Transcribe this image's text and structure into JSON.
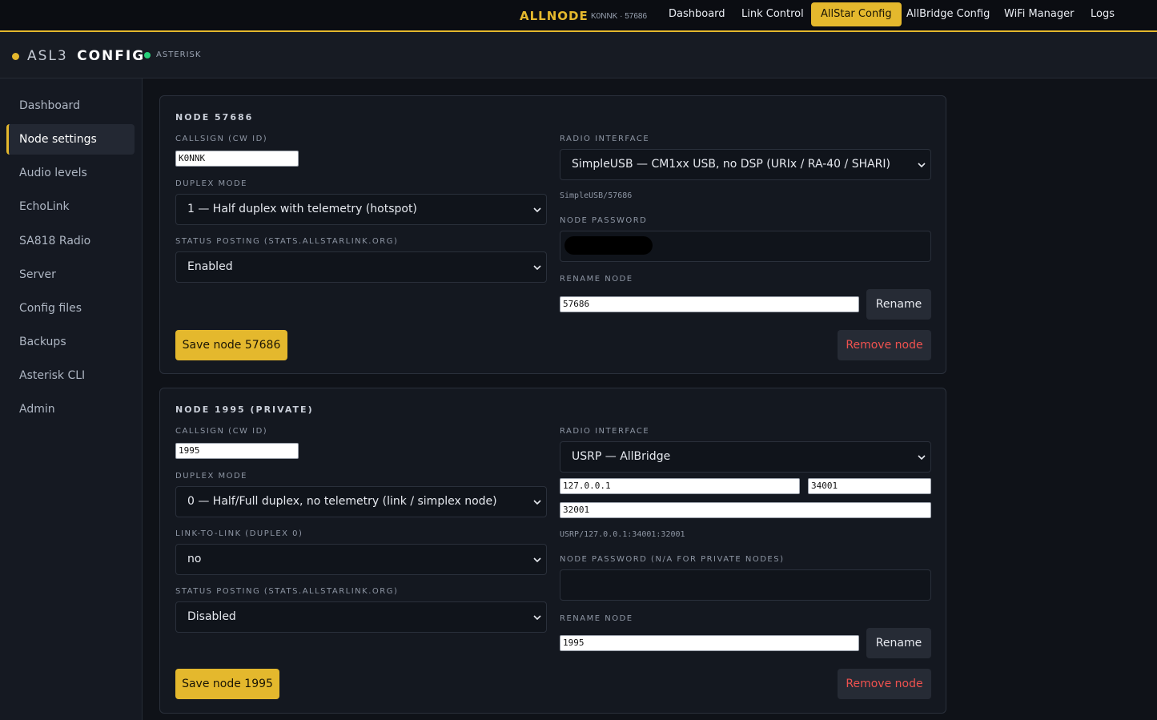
{
  "nav": {
    "brand": "ALLNODE",
    "brand_sub": "K0NNK · 57686",
    "links": [
      "Dashboard",
      "Link Control",
      "AllStar Config",
      "AllBridge Config",
      "WiFi Manager",
      "Logs"
    ],
    "active": "AllStar Config"
  },
  "subheader": {
    "title_light": "ASL3",
    "title_bold": "CONFIG",
    "status": "ASTERISK"
  },
  "sidebar": {
    "items": [
      "Dashboard",
      "Node settings",
      "Audio levels",
      "EchoLink",
      "SA818 Radio",
      "Server",
      "Config files",
      "Backups",
      "Asterisk CLI",
      "Admin"
    ],
    "active": "Node settings"
  },
  "nodes": [
    {
      "title": "NODE 57686",
      "callsign_label": "CALLSIGN (CW ID)",
      "callsign": "K0NNK",
      "duplex_label": "DUPLEX MODE",
      "duplex": "1 — Half duplex with telemetry (hotspot)",
      "status_label": "STATUS POSTING (STATS.ALLSTARLINK.ORG)",
      "status": "Enabled",
      "radio_label": "RADIO INTERFACE",
      "radio": "SimpleUSB — CM1xx USB, no DSP (URIx / RA-40 / SHARI)",
      "channel": "SimpleUSB/57686",
      "password_label": "NODE PASSWORD",
      "rename_label": "RENAME NODE",
      "rename_value": "57686",
      "rename_button": "Rename",
      "save_button": "Save node 57686",
      "remove_button": "Remove node"
    },
    {
      "title": "NODE 1995 (PRIVATE)",
      "callsign_label": "CALLSIGN (CW ID)",
      "callsign": "1995",
      "duplex_label": "DUPLEX MODE",
      "duplex": "0 — Half/Full duplex, no telemetry (link / simplex node)",
      "link_label": "LINK-TO-LINK (DUPLEX 0)",
      "link": "no",
      "status_label": "STATUS POSTING (STATS.ALLSTARLINK.ORG)",
      "status": "Disabled",
      "radio_label": "RADIO INTERFACE",
      "radio": "USRP — AllBridge",
      "usrp_host": "127.0.0.1",
      "usrp_txport": "34001",
      "usrp_rxport": "32001",
      "channel": "USRP/127.0.0.1:34001:32001",
      "password_label": "NODE PASSWORD (N/A FOR PRIVATE NODES)",
      "rename_label": "RENAME NODE",
      "rename_value": "1995",
      "rename_button": "Rename",
      "save_button": "Save node 1995",
      "remove_button": "Remove node"
    }
  ]
}
